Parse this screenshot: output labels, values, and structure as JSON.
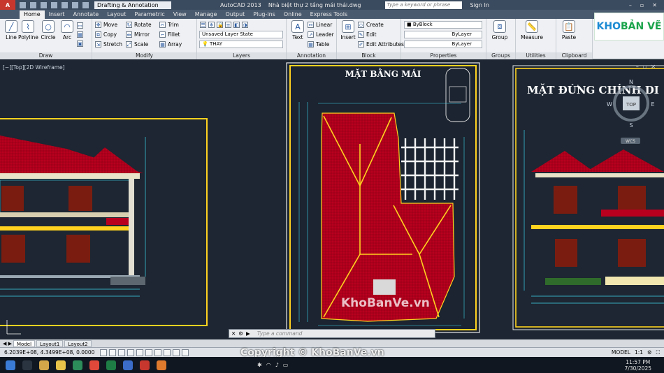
{
  "titlebar": {
    "workspace": "Drafting & Annotation",
    "app": "AutoCAD 2013",
    "document": "Nhà biệt thự 2 tầng mái thái.dwg",
    "search_placeholder": "Type a keyword or phrase",
    "signin": "Sign In"
  },
  "tabs": [
    "Home",
    "Insert",
    "Annotate",
    "Layout",
    "Parametric",
    "View",
    "Manage",
    "Output",
    "Plug-ins",
    "Online",
    "Express Tools"
  ],
  "ribbon": {
    "draw": {
      "title": "Draw",
      "line": "Line",
      "polyline": "Polyline",
      "circle": "Circle",
      "arc": "Arc"
    },
    "modify": {
      "title": "Modify",
      "move": "Move",
      "rotate": "Rotate",
      "trim": "Trim",
      "copy": "Copy",
      "mirror": "Mirror",
      "fillet": "Fillet",
      "stretch": "Stretch",
      "scale": "Scale",
      "array": "Array"
    },
    "layers": {
      "title": "Layers",
      "state": "Unsaved Layer State",
      "layer": "THAY"
    },
    "annotation": {
      "title": "Annotation",
      "text": "Text",
      "linear": "Linear",
      "leader": "Leader",
      "table": "Table"
    },
    "block": {
      "title": "Block",
      "insert": "Insert",
      "create": "Create",
      "edit": "Edit",
      "edit_attributes": "Edit Attributes"
    },
    "properties": {
      "title": "Properties",
      "color": "ByBlock",
      "linetype": "ByLayer",
      "lineweight": "ByLayer"
    },
    "groups": {
      "title": "Groups",
      "group": "Group"
    },
    "utilities": {
      "title": "Utilities",
      "measure": "Measure"
    },
    "clipboard": {
      "title": "Clipboard",
      "paste": "Paste"
    }
  },
  "viewport": {
    "label": "[−][Top][2D Wireframe]",
    "roof_plan_title": "MẶT BẰNG MÁI",
    "elevation_title": "MẶT ĐỨNG CHÍNH DI",
    "viewcube": {
      "top": "TOP",
      "n": "N",
      "s": "S",
      "w": "W",
      "e": "E",
      "wcs": "WCS"
    }
  },
  "command": {
    "placeholder": "Type a command"
  },
  "layout_tabs": [
    "Model",
    "Layout1",
    "Layout2"
  ],
  "status": {
    "coords": "6.2039E+08, 4.3499E+08, 0.0000",
    "model": "MODEL",
    "scale": "1:1"
  },
  "taskbar": {
    "time": "11:57 PM",
    "date": "7/30/2025"
  },
  "watermarks": {
    "brand_k": "KHO",
    "brand_rest": "BẢN VẼ",
    "center": "KhoBanVe.vn",
    "bottom": "Copyright © KhoBanVe.vn"
  },
  "colors": {
    "roof_red": "#b8001e",
    "frame_yellow": "#ffd21f",
    "canvas": "#1d2632",
    "cad_cyan": "#3fd6ee"
  }
}
